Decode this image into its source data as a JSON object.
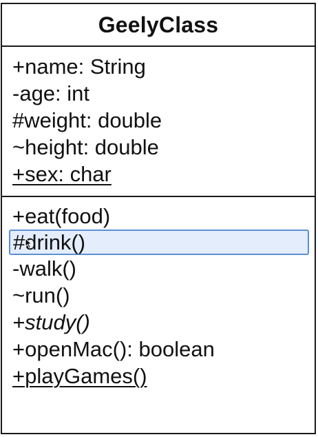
{
  "class": {
    "name": "GeelyClass",
    "attributes": [
      {
        "text": "+name: String",
        "static": false,
        "abstract": false
      },
      {
        "text": "-age: int",
        "static": false,
        "abstract": false
      },
      {
        "text": "#weight: double",
        "static": false,
        "abstract": false
      },
      {
        "text": "~height: double",
        "static": false,
        "abstract": false
      },
      {
        "text": "+sex: char",
        "static": true,
        "abstract": false
      }
    ],
    "methods": [
      {
        "text": "+eat(food)",
        "static": false,
        "abstract": false
      },
      {
        "text": "#drink()",
        "static": false,
        "abstract": false,
        "selected": true
      },
      {
        "text": "-walk()",
        "static": false,
        "abstract": false
      },
      {
        "text": "~run()",
        "static": false,
        "abstract": false
      },
      {
        "text": "+study()",
        "static": false,
        "abstract": true
      },
      {
        "text": "+openMac(): boolean",
        "static": false,
        "abstract": false
      },
      {
        "text": "+playGames()",
        "static": true,
        "abstract": false
      }
    ]
  },
  "colors": {
    "border": "#1a1a1a",
    "selection_border": "#5b8fd6",
    "selection_fill": "#e3edfb"
  },
  "icons": {
    "cursor": "mouse-pointer-icon"
  }
}
